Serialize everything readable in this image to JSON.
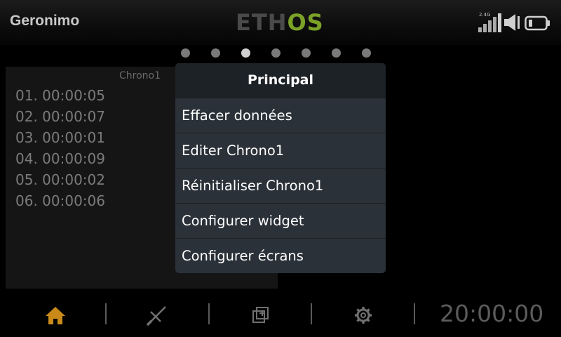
{
  "header": {
    "model_name": "Geronimo",
    "logo_part1": "ETH",
    "logo_part2": "OS",
    "rssi_band": "2.4G",
    "icons": [
      "signal-strength-icon",
      "speaker-icon",
      "battery-icon"
    ]
  },
  "pager": {
    "total": 7,
    "active_index": 2
  },
  "widget": {
    "title": "Chrono1",
    "laps": [
      "01. 00:00:05",
      "02. 00:00:07",
      "03. 00:00:01",
      "04. 00:00:09",
      "05. 00:00:02",
      "06. 00:00:06"
    ]
  },
  "menu": {
    "title": "Principal",
    "items": [
      "Effacer données",
      "Editer Chrono1",
      "Réinitialiser Chrono1",
      "Configurer widget",
      "Configurer écrans"
    ]
  },
  "navbar": {
    "buttons": [
      "home-icon",
      "model-setup-icon",
      "screens-icon",
      "settings-icon"
    ],
    "active_button": "home-icon",
    "clock": "20:00:00"
  },
  "colors": {
    "accent_orange": "#c98a1a",
    "logo_green": "#7ba227",
    "menu_bg": "#2b3138",
    "menu_header_bg": "#1d2227"
  }
}
